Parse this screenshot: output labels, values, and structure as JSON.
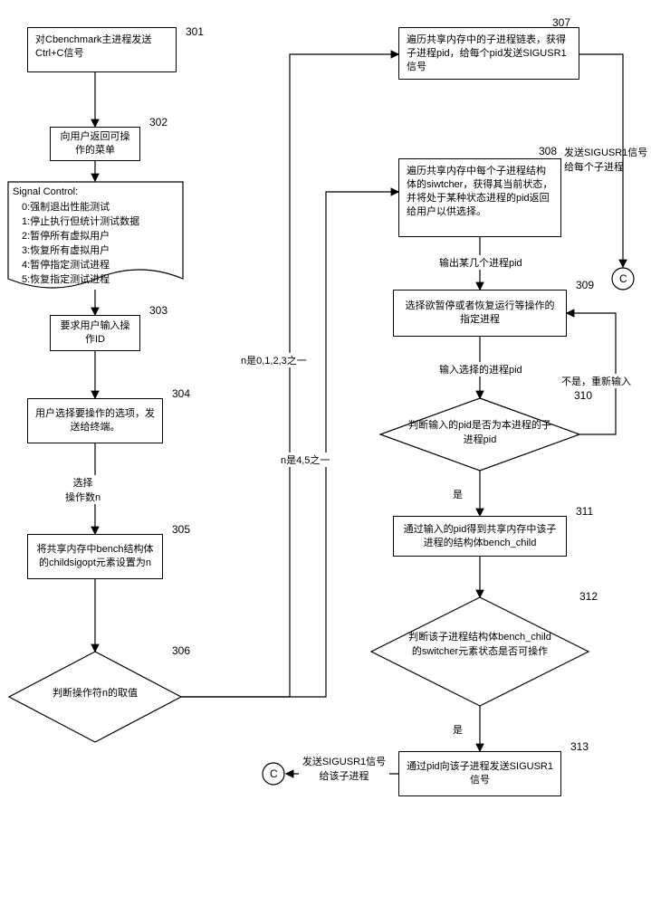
{
  "nodes": {
    "n301": {
      "num": "301",
      "text": "对Cbenchmark主进程发送Ctrl+C信号"
    },
    "n302": {
      "num": "302",
      "text": "向用户返回可操作的菜单"
    },
    "menu": {
      "title": "Signal Control:",
      "lines": [
        "0:强制退出性能测试",
        "1:停止执行但统计测试数据",
        "2:暂停所有虚拟用户",
        "3:恢复所有虚拟用户",
        "4:暂停指定测试进程",
        "5:恢复指定测试进程"
      ]
    },
    "n303": {
      "num": "303",
      "text": "要求用户输入操作ID"
    },
    "n304": {
      "num": "304",
      "text": "用户选择要操作的选项，发送给终端。"
    },
    "n305": {
      "num": "305",
      "text": "将共享内存中bench结构体的childsigopt元素设置为n"
    },
    "n306": {
      "num": "306",
      "text": "判断操作符n的取值"
    },
    "n307": {
      "num": "307",
      "text": "遍历共享内存中的子进程链表，获得子进程pid，给每个pid发送SIGUSR1信号"
    },
    "n308": {
      "num": "308",
      "text": "遍历共享内存中每个子进程结构体的siwtcher，获得其当前状态，并将处于某种状态进程的pid返回给用户以供选择。",
      "side": "发送SIGUSR1信号给每个子进程"
    },
    "n309": {
      "num": "309",
      "text": "选择欲暂停或者恢复运行等操作的指定进程"
    },
    "n310": {
      "num": "310",
      "text": "判断输入的pid是否为本进程的子进程pid"
    },
    "n311": {
      "num": "311",
      "text": "通过输入的pid得到共享内存中该子进程的结构体bench_child"
    },
    "n312": {
      "num": "312",
      "text": "判断该子进程结构体bench_child的switcher元素状态是否可操作"
    },
    "n313": {
      "num": "313",
      "text": "通过pid向该子进程发送SIGUSR1信号"
    }
  },
  "edges": {
    "e_select_n": "选择\n操作数n",
    "e_n0123": "n是0,1,2,3之一",
    "e_n45": "n是4,5之一",
    "e_out_pid": "输出某几个进程pid",
    "e_input_pid": "输入选择的进程pid",
    "e_no_reenter": "不是，重新输入",
    "e_yes1": "是",
    "e_yes2": "是",
    "e_send_child": "发送SIGUSR1信号给该子进程"
  },
  "connectors": {
    "c1": "C",
    "c2": "C"
  }
}
